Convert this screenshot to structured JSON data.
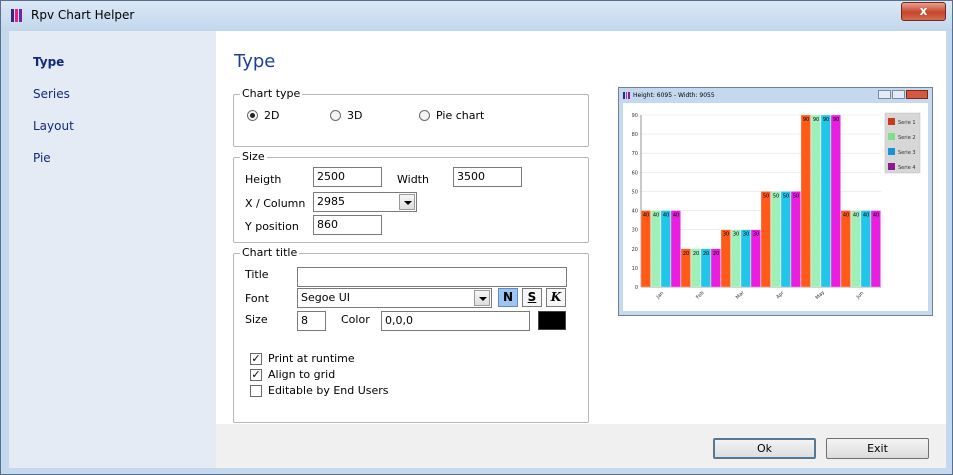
{
  "window": {
    "title": "Rpv Chart Helper",
    "close_label": "x"
  },
  "sidebar": {
    "items": [
      {
        "label": "Type",
        "active": true
      },
      {
        "label": "Series",
        "active": false
      },
      {
        "label": "Layout",
        "active": false
      },
      {
        "label": "Pie",
        "active": false
      }
    ]
  },
  "page": {
    "title": "Type"
  },
  "chart_type": {
    "group_label": "Chart type",
    "options": [
      {
        "label": "2D",
        "checked": true
      },
      {
        "label": "3D",
        "checked": false
      },
      {
        "label": "Pie chart",
        "checked": false
      }
    ]
  },
  "size": {
    "group_label": "Size",
    "height_label": "Heigth",
    "height_value": "2500",
    "width_label": "Width",
    "width_value": "3500",
    "xcol_label": "X / Column",
    "xcol_value": "2985",
    "ypos_label": "Y position",
    "ypos_value": "860"
  },
  "chart_title": {
    "group_label": "Chart title",
    "title_label": "Title",
    "title_value": "",
    "font_label": "Font",
    "font_value": "Segoe UI",
    "bold_glyph": "N",
    "underline_glyph": "S",
    "italic_glyph": "K",
    "size_label": "Size",
    "size_value": "8",
    "color_label": "Color",
    "color_value": "0,0,0",
    "swatch_color": "#000000"
  },
  "options": [
    {
      "label": "Print at runtime",
      "checked": true
    },
    {
      "label": "Align to grid",
      "checked": true
    },
    {
      "label": "Editable by End Users",
      "checked": false
    }
  ],
  "buttons": {
    "ok": "Ok",
    "exit": "Exit"
  },
  "preview": {
    "title": "Height: 6095 - Width: 9055"
  },
  "chart_data": {
    "type": "bar",
    "categories": [
      "Jan",
      "Feb",
      "Mar",
      "Apr",
      "May",
      "Jun"
    ],
    "series": [
      {
        "name": "Serie 1",
        "color": "#ff5a1a",
        "values": [
          40,
          20,
          30,
          50,
          90,
          40
        ]
      },
      {
        "name": "Serie 2",
        "color": "#9ef0b8",
        "values": [
          40,
          20,
          30,
          50,
          90,
          40
        ]
      },
      {
        "name": "Serie 3",
        "color": "#22c6e8",
        "values": [
          40,
          20,
          30,
          50,
          90,
          40
        ]
      },
      {
        "name": "Serie 4",
        "color": "#e81ee0",
        "values": [
          40,
          20,
          30,
          50,
          90,
          40
        ]
      }
    ],
    "legend_colors": [
      "#c83a20",
      "#7fe08c",
      "#1a93d6",
      "#8b1a8e"
    ],
    "yticks": [
      0,
      10,
      20,
      30,
      40,
      50,
      60,
      70,
      80,
      90
    ],
    "ylim": [
      0,
      90
    ],
    "grid": true,
    "legend_position": "top-right"
  }
}
